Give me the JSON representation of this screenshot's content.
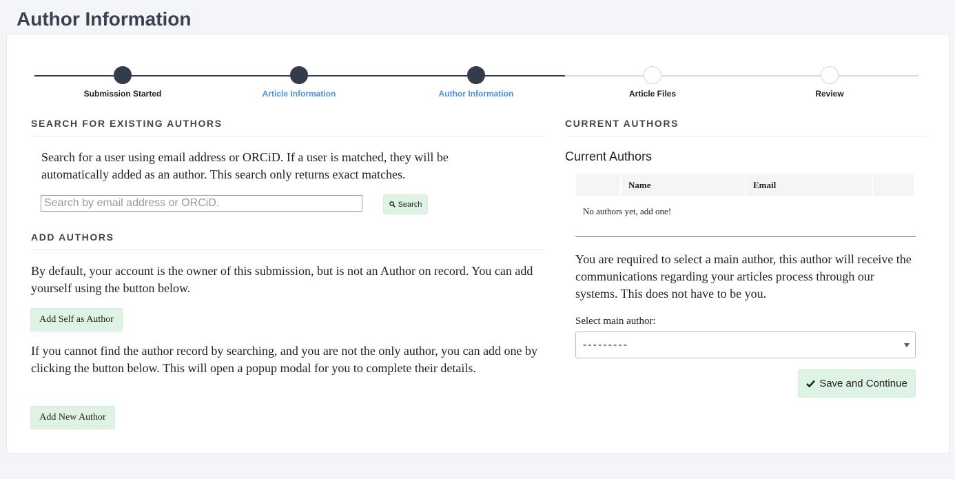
{
  "page": {
    "title": "Author Information"
  },
  "stepper": {
    "steps": [
      {
        "label": "Submission Started",
        "state": "done"
      },
      {
        "label": "Article Information",
        "state": "done"
      },
      {
        "label": "Author Information",
        "state": "current"
      },
      {
        "label": "Article Files",
        "state": "todo"
      },
      {
        "label": "Review",
        "state": "todo"
      }
    ]
  },
  "search_section": {
    "heading": "SEARCH FOR EXISTING AUTHORS",
    "description": "Search for a user using email address or ORCiD. If a user is matched, they will be automatically added as an author. This search only returns exact matches.",
    "placeholder": "Search by email address or ORCiD.",
    "button_label": "Search"
  },
  "add_section": {
    "heading": "ADD AUTHORS",
    "self_text": "By default, your account is the owner of this submission, but is not an Author on record. You can add yourself using the button below.",
    "self_button": "Add Self as Author",
    "new_text": "If you cannot find the author record by searching, and you are not the only author, you can add one by clicking the button below. This will open a popup modal for you to complete their details.",
    "new_button": "Add New Author"
  },
  "current_section": {
    "heading": "CURRENT AUTHORS",
    "subtitle": "Current Authors",
    "columns": [
      "",
      "Name",
      "Email",
      ""
    ],
    "empty_text": "No authors yet, add one!",
    "main_author_text": "You are required to select a main author, this author will receive the communications regarding your articles process through our systems. This does not have to be you.",
    "select_label": "Select main author:",
    "select_value": "---------",
    "save_button": "Save and Continue"
  },
  "colors": {
    "accent_dark": "#343b4a",
    "link": "#4a90d9",
    "button_green": "#dff3e4"
  }
}
